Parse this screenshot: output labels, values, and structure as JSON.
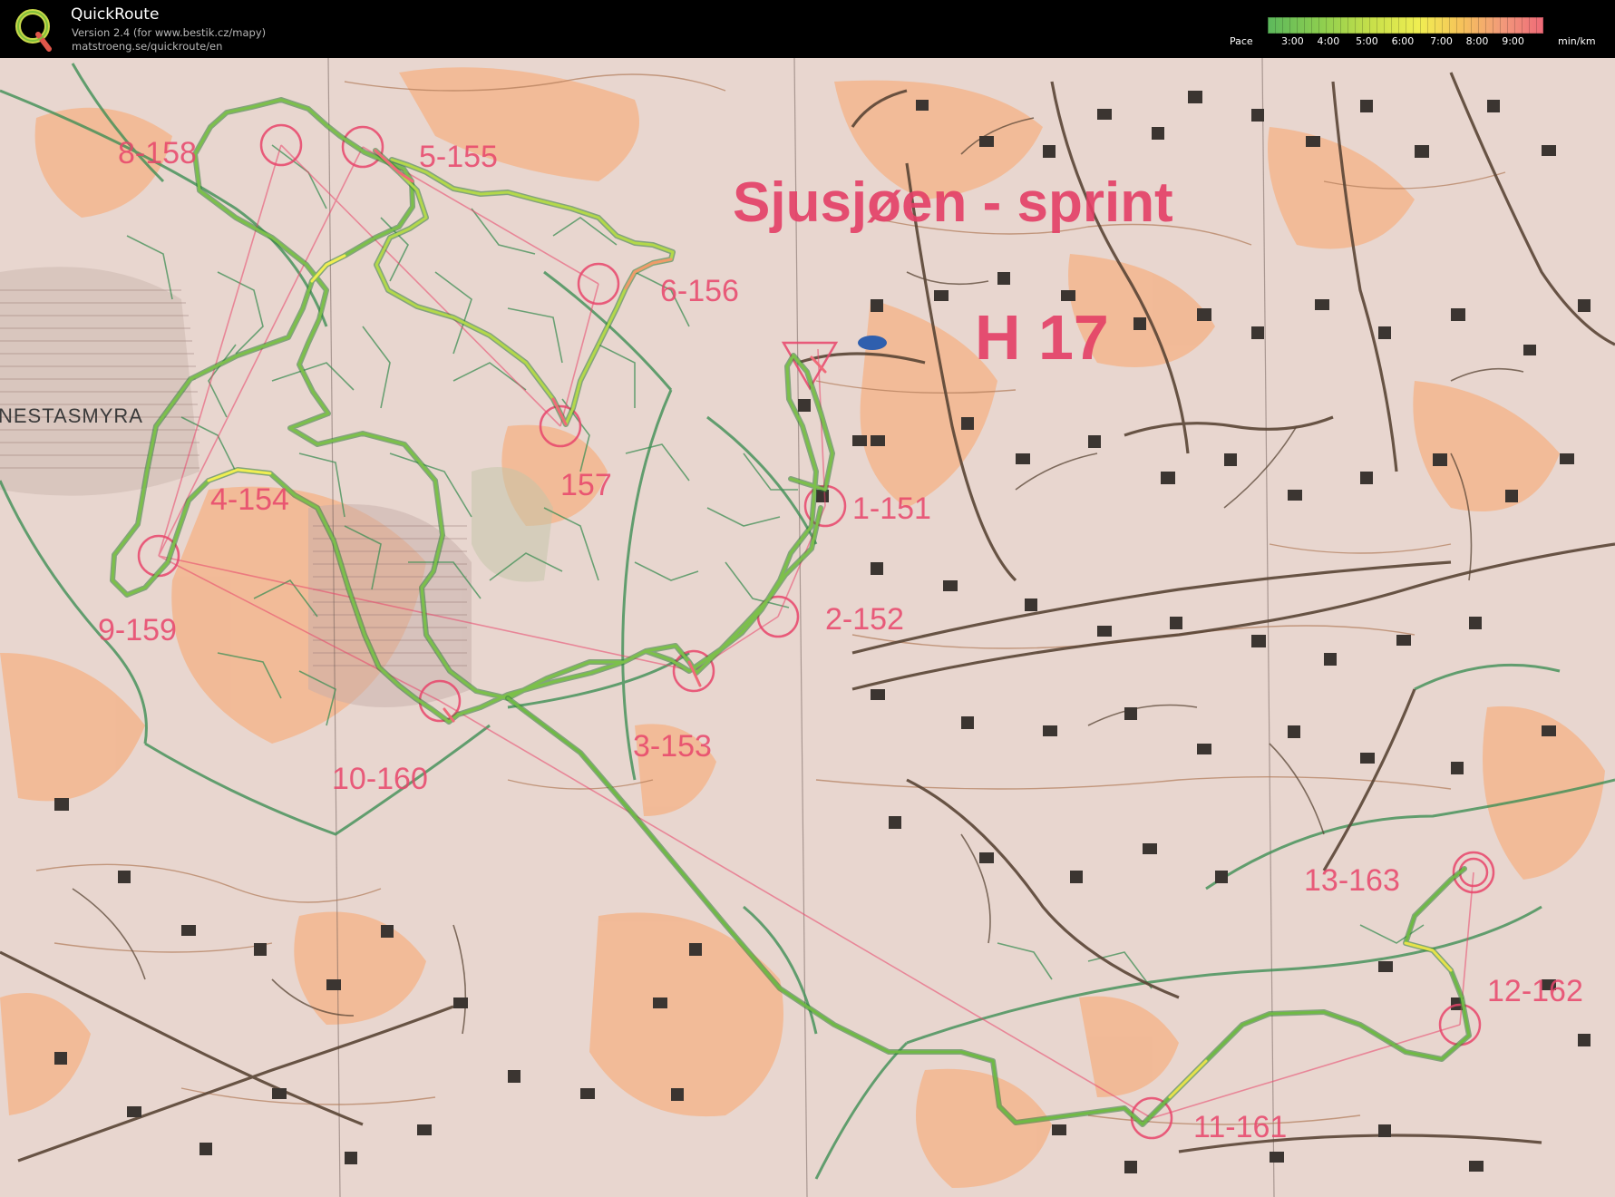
{
  "app": {
    "name": "QuickRoute",
    "version": "Version 2.4  (for www.bestik.cz/mapy)",
    "site": "matstroeng.se/quickroute/en"
  },
  "pace_legend": {
    "label": "Pace",
    "ticks": [
      "3:00",
      "4:00",
      "5:00",
      "6:00",
      "7:00",
      "8:00",
      "9:00"
    ],
    "unit": "min/km",
    "colors": {
      "fast": "#5cb85c",
      "medium": "#f0ee52",
      "slow": "#ef6a78"
    }
  },
  "map": {
    "title": "Sjusjøen - sprint",
    "class": "H 17",
    "place_name": "NESTASMYRA",
    "controls": [
      {
        "id": "1",
        "label": "1-151"
      },
      {
        "id": "2",
        "label": "2-152"
      },
      {
        "id": "3",
        "label": "3-153"
      },
      {
        "id": "4",
        "label": "4-154"
      },
      {
        "id": "5",
        "label": "5-155"
      },
      {
        "id": "6",
        "label": "6-156"
      },
      {
        "id": "7",
        "label": "157"
      },
      {
        "id": "8",
        "label": "8-158"
      },
      {
        "id": "9",
        "label": "9-159"
      },
      {
        "id": "10",
        "label": "10-160"
      },
      {
        "id": "11",
        "label": "11-161"
      },
      {
        "id": "12",
        "label": "12-162"
      },
      {
        "id": "13",
        "label": "13-163"
      }
    ],
    "colors": {
      "paper": "#e7d7cf",
      "open_land": "#f2b48a",
      "vegetation_green": "#3f8f55",
      "course_magenta": "#e8456b",
      "road_brown": "#5a4535",
      "building": "#3b3531"
    }
  }
}
